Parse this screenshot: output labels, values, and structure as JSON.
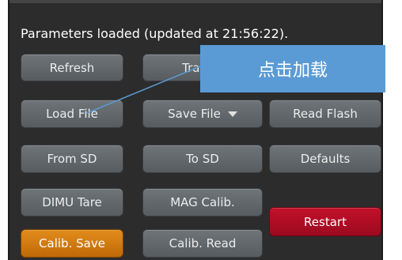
{
  "status_text": "Parameters loaded (updated at 21:56:22).",
  "buttons": {
    "refresh": "Refresh",
    "transfer": "Trans",
    "load_file": "Load File",
    "save_file": "Save File",
    "read_flash": "Read Flash",
    "from_sd": "From SD",
    "to_sd": "To SD",
    "defaults": "Defaults",
    "dimu_tare": "DIMU Tare",
    "mag_calib": "MAG Calib.",
    "restart": "Restart",
    "calib_save": "Calib. Save",
    "calib_read": "Calib. Read"
  },
  "icons": {
    "save_file_dropdown": "caret-down-icon"
  },
  "callout": {
    "text": "点击加载"
  },
  "colors": {
    "panel_bg": "#2c2c2c",
    "button_gray": "#63686c",
    "button_orange": "#d47a10",
    "button_red": "#b00d26",
    "callout_blue": "#5b9bd5"
  }
}
